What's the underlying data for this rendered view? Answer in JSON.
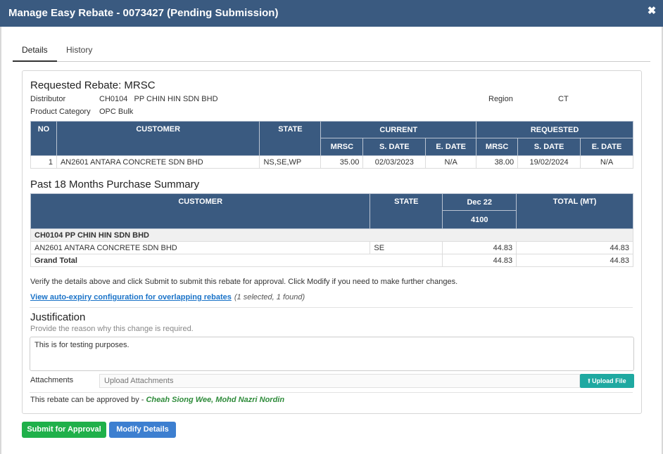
{
  "window": {
    "title": "Manage Easy Rebate - 0073427 (Pending Submission)"
  },
  "tabs": [
    {
      "label": "Details"
    },
    {
      "label": "History"
    }
  ],
  "requested": {
    "heading": "Requested Rebate: MRSC",
    "distributor_label": "Distributor",
    "distributor_value": "CH0104   PP CHIN HIN SDN BHD",
    "region_label": "Region",
    "region_value": "CT",
    "category_label": "Product Category",
    "category_value": "OPC Bulk",
    "headers": {
      "no": "NO",
      "customer": "CUSTOMER",
      "state": "STATE",
      "current": "CURRENT",
      "requested": "REQUESTED",
      "mrsc": "MRSC",
      "sdate": "S. DATE",
      "edate": "E. DATE"
    },
    "row": {
      "no": "1",
      "customer": "AN2601 ANTARA CONCRETE SDN BHD",
      "state": "NS,SE,WP",
      "cur_mrsc": "35.00",
      "cur_sdate": "02/03/2023",
      "cur_edate": "N/A",
      "req_mrsc": "38.00",
      "req_sdate": "19/02/2024",
      "req_edate": "N/A"
    }
  },
  "summary": {
    "heading": "Past 18 Months Purchase Summary",
    "headers": {
      "customer": "CUSTOMER",
      "state": "STATE",
      "month": "Dec 22",
      "month_code": "4100",
      "total": "TOTAL (MT)"
    },
    "group": "CH0104 PP CHIN HIN SDN BHD",
    "row": {
      "customer": "AN2601 ANTARA CONCRETE SDN BHD",
      "state": "SE",
      "value": "44.83",
      "total": "44.83"
    },
    "grand": {
      "label": "Grand Total",
      "value": "44.83",
      "total": "44.83"
    }
  },
  "note": "Verify the details above and click Submit to submit this rebate for approval. Click Modify if you need to make further changes.",
  "link": {
    "text": "View auto-expiry configuration for overlapping rebates",
    "meta": "(1 selected, 1 found)"
  },
  "justification": {
    "title": "Justification",
    "help": "Provide the reason why this change is required.",
    "value": "This is for testing purposes."
  },
  "attachments": {
    "label": "Attachments",
    "placeholder": "Upload Attachments",
    "button": "Upload File"
  },
  "approver": {
    "prefix": "This rebate can be approved by - ",
    "names": "Cheah Siong Wee, Mohd Nazri Nordin"
  },
  "buttons": {
    "submit": "Submit for Approval",
    "modify": "Modify Details"
  },
  "colors": {
    "header": "#3a5a80",
    "submit": "#1fb04a",
    "modify": "#3d7fd0",
    "upload": "#1fa9a1"
  },
  "icons": {
    "close": "close-icon",
    "upload": "upload-icon"
  }
}
